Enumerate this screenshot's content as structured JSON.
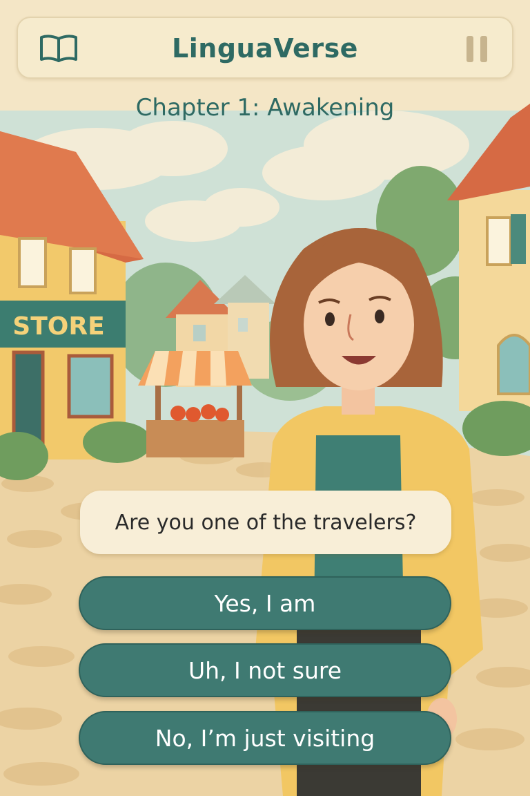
{
  "app": {
    "title": "LinguaVerse"
  },
  "header": {
    "book_icon": "book-icon",
    "pause_icon": "pause-icon"
  },
  "chapter": {
    "title": "Chapter 1: Awakening"
  },
  "scene": {
    "store_sign": "STORE"
  },
  "dialogue": {
    "text": "Are you one of the travelers?"
  },
  "choices": [
    {
      "label": "Yes, I am"
    },
    {
      "label": "Uh, I not sure"
    },
    {
      "label": "No, I’m just visiting"
    }
  ],
  "colors": {
    "accent": "#2e6a63",
    "button": "#3f7a72",
    "panel": "#f6ebcd",
    "sky": "#cfe1d6"
  }
}
